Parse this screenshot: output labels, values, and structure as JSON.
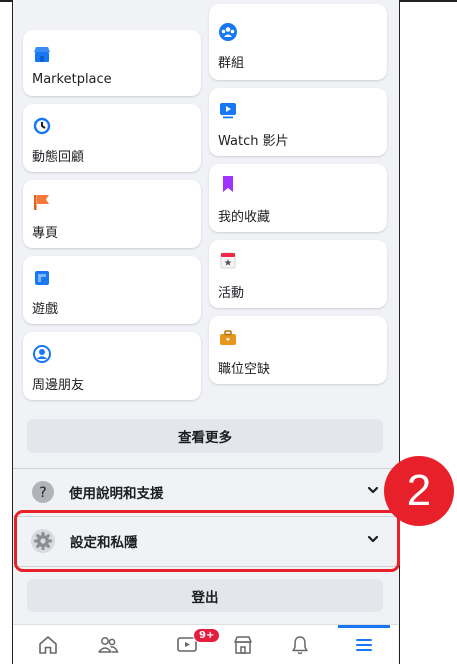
{
  "shortcuts_left": [
    {
      "label": "Marketplace",
      "icon": "marketplace-icon"
    },
    {
      "label": "動態回顧",
      "icon": "memories-icon"
    },
    {
      "label": "專頁",
      "icon": "pages-icon"
    },
    {
      "label": "遊戲",
      "icon": "gaming-icon"
    },
    {
      "label": "周邊朋友",
      "icon": "nearby-friends-icon"
    }
  ],
  "shortcuts_right": [
    {
      "label": "群組",
      "icon": "groups-icon"
    },
    {
      "label": "Watch 影片",
      "icon": "watch-icon"
    },
    {
      "label": "我的收藏",
      "icon": "saved-icon"
    },
    {
      "label": "活動",
      "icon": "events-icon"
    },
    {
      "label": "職位空缺",
      "icon": "jobs-icon"
    }
  ],
  "see_more": "查看更多",
  "help_support": "使用說明和支援",
  "settings_privacy": "設定和私隱",
  "logout": "登出",
  "step_badge": "2",
  "nav": {
    "notification_badge": "9+",
    "items": [
      "home-icon",
      "friends-icon",
      "watch-nav-icon",
      "marketplace-nav-icon",
      "notifications-icon",
      "menu-icon"
    ]
  },
  "colors": {
    "highlight": "#e8202a",
    "accent": "#1877f2",
    "background": "#f0f2f5"
  }
}
